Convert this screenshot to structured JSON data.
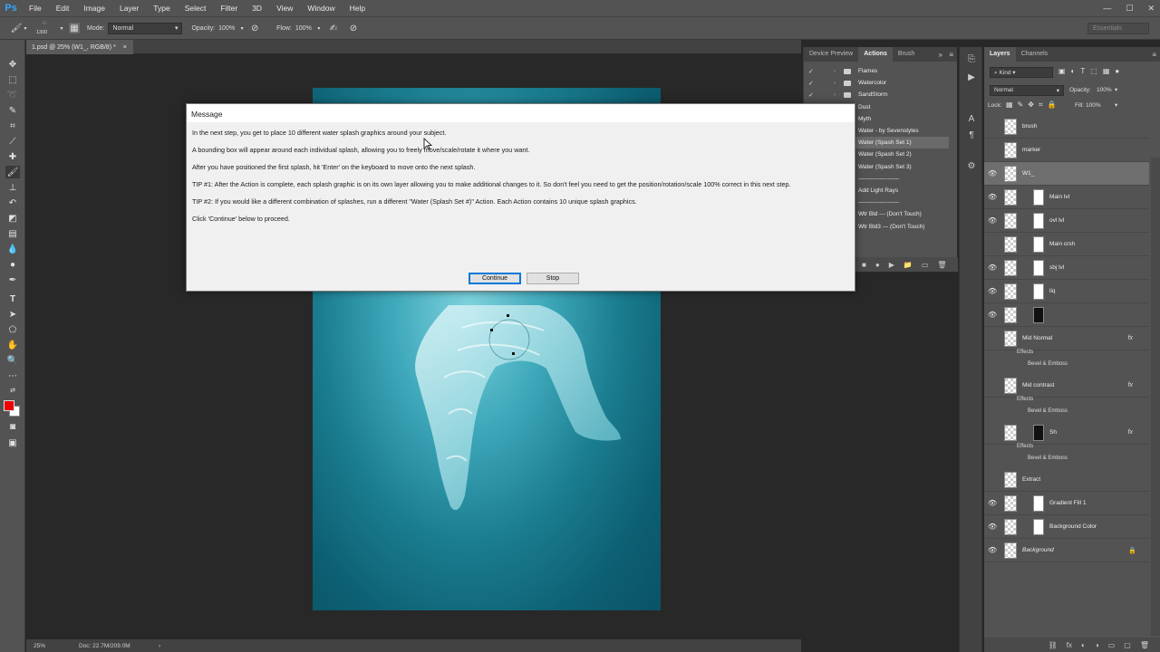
{
  "app": {
    "logo": "Ps"
  },
  "menu": [
    "File",
    "Edit",
    "Image",
    "Layer",
    "Type",
    "Select",
    "Filter",
    "3D",
    "View",
    "Window",
    "Help"
  ],
  "window_controls": {
    "minimize": "—",
    "maximize": "☐",
    "close": "✕"
  },
  "options_bar": {
    "brush_size": "1300",
    "mode_label": "Mode:",
    "mode_value": "Normal",
    "opacity_label": "Opacity:",
    "opacity_value": "100%",
    "flow_label": "Flow:",
    "flow_value": "100%",
    "workspace": "Essentials"
  },
  "document": {
    "tab_title": "1.psd @ 25% (W1_, RGB/8) *",
    "close": "×"
  },
  "status": {
    "zoom": "25%",
    "doc_size": "Doc: 22.7M/209.0M",
    "arrow": "›"
  },
  "colors": {
    "foreground": "#ee0000",
    "background": "#ffffff",
    "canvas_top": "#7ed2dd",
    "canvas_bottom": "#0a5365"
  },
  "actions_panel": {
    "tabs": [
      "Device Preview",
      "Actions",
      "Brush"
    ],
    "rows": [
      {
        "label": "Flames",
        "folder": true,
        "check": "✓"
      },
      {
        "label": "Watercolor",
        "folder": true,
        "check": "✓"
      },
      {
        "label": "SandStorm",
        "folder": true,
        "check": "✓"
      },
      {
        "label": "Dust",
        "folder": false,
        "check": ""
      },
      {
        "label": "Myth",
        "folder": false,
        "check": ""
      },
      {
        "label": "Water - by Sevenstyles",
        "folder": false,
        "check": ""
      },
      {
        "label": "Water (Spash Set 1)",
        "folder": false,
        "check": "",
        "selected": true
      },
      {
        "label": "Water (Spash Set 2)",
        "folder": false,
        "check": ""
      },
      {
        "label": "Water (Spash Set 3)",
        "folder": false,
        "check": ""
      },
      {
        "label": "---------------------",
        "folder": false,
        "check": ""
      },
      {
        "label": "Add Light Rays",
        "folder": false,
        "check": ""
      },
      {
        "label": "---------------------",
        "folder": false,
        "check": ""
      },
      {
        "label": "Wtr Bld --- (Don't Touch)",
        "folder": false,
        "check": ""
      },
      {
        "label": "Wtr Bld3 --- (Don't Touch)",
        "folder": false,
        "check": ""
      }
    ]
  },
  "layers_panel": {
    "tabs": [
      "Layers",
      "Channels"
    ],
    "kind": "Kind",
    "blend_mode": "Normal",
    "opacity_label": "Opacity:",
    "opacity_value": "100%",
    "lock_label": "Lock:",
    "fill_label": "Fill:",
    "fill_value": "100%",
    "layers": [
      {
        "name": "brush",
        "visible": false
      },
      {
        "name": "marker",
        "visible": false
      },
      {
        "name": "W1_",
        "visible": true,
        "selected": true
      },
      {
        "name": "Main lvl",
        "visible": true
      },
      {
        "name": "ovl lvl",
        "visible": true
      },
      {
        "name": "Main crsh",
        "visible": false
      },
      {
        "name": "sbj lvl",
        "visible": true
      },
      {
        "name": "liq",
        "visible": true
      },
      {
        "name": "",
        "visible": true
      },
      {
        "name": "Mid Normal",
        "visible": false,
        "fx": "fx",
        "effects": "Effects",
        "effect_item": "Bevel & Emboss"
      },
      {
        "name": "Mid contrast",
        "visible": false,
        "fx": "fx",
        "effects": "Effects",
        "effect_item": "Bevel & Emboss"
      },
      {
        "name": "Sh",
        "visible": false,
        "fx": "fx",
        "effects": "Effects",
        "effect_item": "Bevel & Emboss"
      },
      {
        "name": "Extract",
        "visible": false
      },
      {
        "name": "Gradient Fill 1",
        "visible": true
      },
      {
        "name": "Background Color",
        "visible": true
      },
      {
        "name": "Background",
        "visible": true,
        "italic": true
      }
    ],
    "footer_icons": [
      "⛓",
      "fx",
      "◐",
      "◑",
      "▭",
      "▢",
      "🗑"
    ]
  },
  "dialog": {
    "title": "Message",
    "paragraphs": [
      "In the next step, you get to place 10 different water splash graphics around your subject.",
      "A bounding box will appear around each individual splash, allowing you to freely move/scale/rotate it where you want.",
      "After you have positioned the first splash, hit 'Enter' on the keyboard to move onto the next splash.",
      "TIP #1: After the Action is complete, each splash graphic is on its own layer allowing you to make additional changes to it. So don't feel you need to get the position/rotation/scale 100% correct in this next step.",
      "TIP #2: If you would like a different combination of splashes, run a different \"Water (Splash Set #)\" Action. Each Action contains 10 unique splash graphics.",
      "Click 'Continue' below to proceed."
    ],
    "continue_label": "Continue",
    "stop_label": "Stop"
  }
}
